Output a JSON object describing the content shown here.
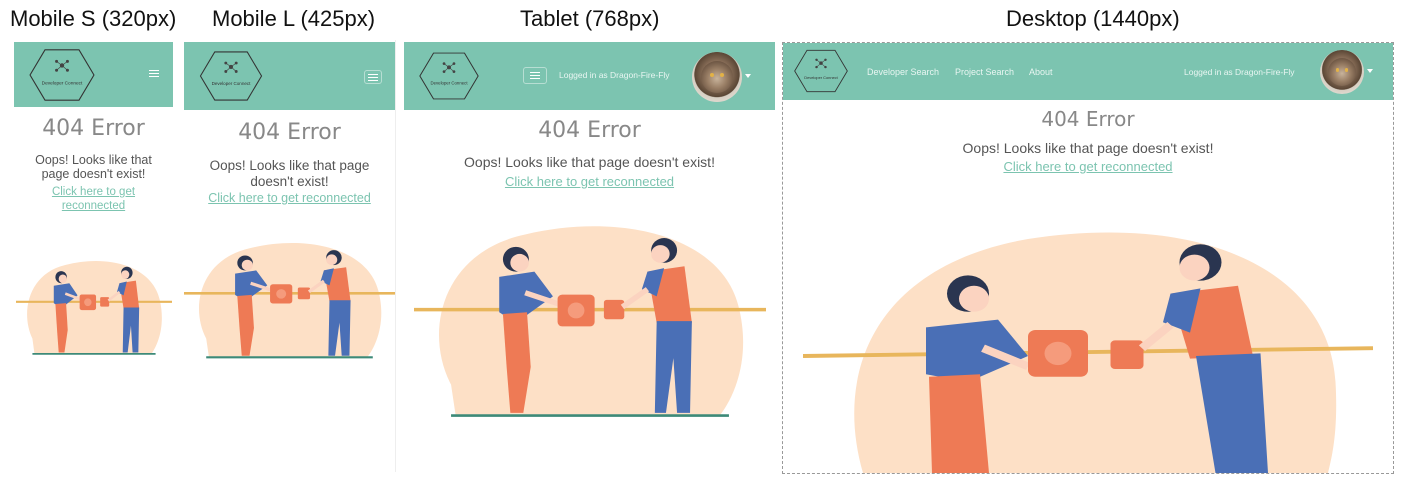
{
  "labels": {
    "mobile_s": "Mobile S (320px)",
    "mobile_l": "Mobile L (425px)",
    "tablet": "Tablet (768px)",
    "desktop": "Desktop (1440px)"
  },
  "navbar": {
    "logo_text": "Developer Connect",
    "links": [
      "Developer Search",
      "Project Search",
      "About"
    ],
    "logged_in": "Logged in as Dragon-Fire-Fly"
  },
  "page": {
    "title": "404 Error",
    "message": "Oops! Looks like that page doesn't exist!",
    "link": "Click here to get reconnected"
  },
  "colors": {
    "navbar": "#7cc4b0",
    "link": "#7cc4b0",
    "blob": "#fde0c6",
    "shirt_orange": "#ee7a55",
    "shirt_blue": "#4a6fb6",
    "cable": "#e8b65c"
  },
  "icons": {
    "menu": "hamburger-icon",
    "avatar": "cat-avatar",
    "dropdown": "caret-down-icon"
  }
}
